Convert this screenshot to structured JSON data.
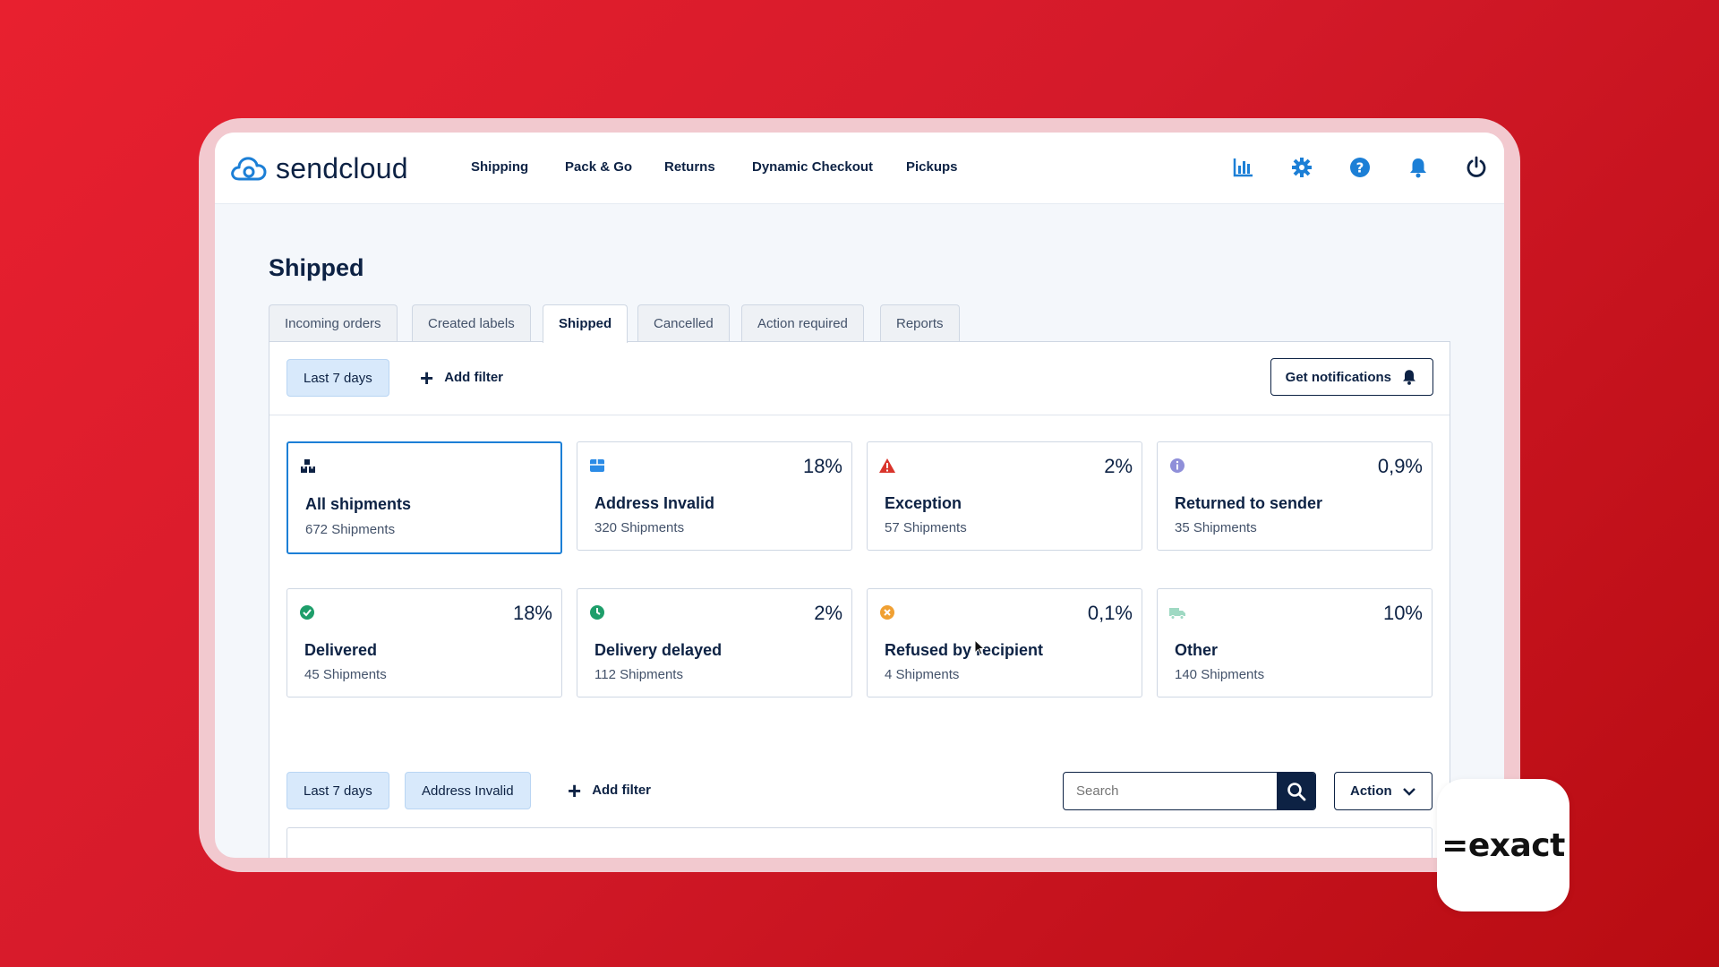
{
  "app": {
    "logo_text": "sendcloud"
  },
  "nav": {
    "links": [
      "Shipping",
      "Pack & Go",
      "Returns",
      "Dynamic Checkout",
      "Pickups"
    ],
    "icons": [
      "analytics-icon",
      "gear-icon",
      "help-icon",
      "bell-icon",
      "power-icon"
    ]
  },
  "page": {
    "title": "Shipped"
  },
  "tabs": [
    "Incoming orders",
    "Created labels",
    "Shipped",
    "Cancelled",
    "Action required",
    "Reports"
  ],
  "active_tab": "Shipped",
  "top_filters": {
    "chip": "Last 7 days",
    "add_filter": "Add filter",
    "notifications": "Get notifications"
  },
  "cards": [
    {
      "title": "All shipments",
      "sub": "672 Shipments",
      "pct": "",
      "icon": "boxes-icon",
      "color": "#0d2244",
      "selected": true
    },
    {
      "title": "Address Invalid",
      "sub": "320 Shipments",
      "pct": "18%",
      "icon": "package-icon",
      "color": "#2b8be6"
    },
    {
      "title": "Exception",
      "sub": "57 Shipments",
      "pct": "2%",
      "icon": "warning-icon",
      "color": "#d9342b"
    },
    {
      "title": "Returned to sender",
      "sub": "35 Shipments",
      "pct": "0,9%",
      "icon": "info-icon",
      "color": "#8f8fd9"
    },
    {
      "title": "Delivered",
      "sub": "45 Shipments",
      "pct": "18%",
      "icon": "check-circle-icon",
      "color": "#1e9e6a"
    },
    {
      "title": "Delivery delayed",
      "sub": "112 Shipments",
      "pct": "2%",
      "icon": "clock-icon",
      "color": "#1e9e6a"
    },
    {
      "title": "Refused by recipient",
      "sub": "4 Shipments",
      "pct": "0,1%",
      "icon": "x-circle-icon",
      "color": "#f0a033"
    },
    {
      "title": "Other",
      "sub": "140 Shipments",
      "pct": "10%",
      "icon": "truck-icon",
      "color": "#9fd9c3"
    }
  ],
  "bottom_filters": {
    "chip_date": "Last 7 days",
    "chip_status": "Address Invalid",
    "add_filter": "Add filter",
    "search_placeholder": "Search",
    "action": "Action"
  },
  "badge": {
    "text": "=exact"
  },
  "colors": {
    "brand": "#0d2244",
    "accent": "#1c7fd6",
    "chip_bg": "#d8e9fb",
    "background_red": "#e01b2b"
  }
}
